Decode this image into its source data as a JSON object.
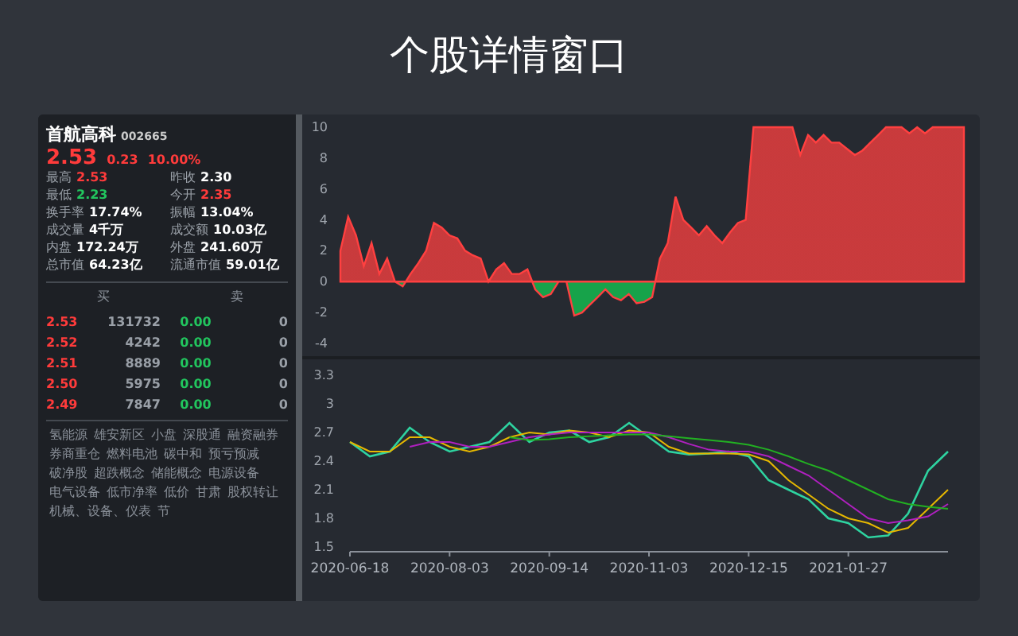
{
  "title": "个股详情窗口",
  "stock": {
    "name": "首航高科",
    "code": "002665",
    "price": "2.53",
    "change": "0.23",
    "change_pct": "10.00%"
  },
  "stats": [
    {
      "label": "最高",
      "value": "2.53",
      "color": "#ff3b3b"
    },
    {
      "label": "昨收",
      "value": "2.30",
      "color": "#ffffff"
    },
    {
      "label": "最低",
      "value": "2.23",
      "color": "#22c55e"
    },
    {
      "label": "今开",
      "value": "2.35",
      "color": "#ff3b3b"
    },
    {
      "label": "换手率",
      "value": "17.74%",
      "color": "#ffffff"
    },
    {
      "label": "振幅",
      "value": "13.04%",
      "color": "#ffffff"
    },
    {
      "label": "成交量",
      "value": "4千万",
      "color": "#ffffff"
    },
    {
      "label": "成交额",
      "value": "10.03亿",
      "color": "#ffffff"
    },
    {
      "label": "内盘",
      "value": "172.24万",
      "color": "#ffffff"
    },
    {
      "label": "外盘",
      "value": "241.60万",
      "color": "#ffffff"
    },
    {
      "label": "总市值",
      "value": "64.23亿",
      "color": "#ffffff"
    },
    {
      "label": "流通市值",
      "value": "59.01亿",
      "color": "#ffffff"
    }
  ],
  "order_book": {
    "buy_header": "买",
    "sell_header": "卖",
    "rows": [
      {
        "buy_price": "2.53",
        "buy_volume": "131732",
        "sell_price": "0.00",
        "sell_volume": "0"
      },
      {
        "buy_price": "2.52",
        "buy_volume": "4242",
        "sell_price": "0.00",
        "sell_volume": "0"
      },
      {
        "buy_price": "2.51",
        "buy_volume": "8889",
        "sell_price": "0.00",
        "sell_volume": "0"
      },
      {
        "buy_price": "2.50",
        "buy_volume": "5975",
        "sell_price": "0.00",
        "sell_volume": "0"
      },
      {
        "buy_price": "2.49",
        "buy_volume": "7847",
        "sell_price": "0.00",
        "sell_volume": "0"
      }
    ]
  },
  "tags": [
    "氢能源",
    "雄安新区",
    "小盘",
    "深股通",
    "融资融券",
    "券商重仓",
    "燃料电池",
    "碳中和",
    "预亏预减",
    "破净股",
    "超跌概念",
    "储能概念",
    "电源设备",
    "电气设备",
    "低市净率",
    "低价",
    "甘肃",
    "股权转让",
    "机械、设备、仪表",
    "节"
  ],
  "change_chart": {
    "chart_data": {
      "type": "area",
      "ylim": [
        -4,
        10
      ],
      "yticks": [
        -4,
        -2,
        0,
        2,
        4,
        6,
        8,
        10
      ],
      "categories": [
        null,
        null,
        null,
        null,
        null,
        null,
        null,
        null,
        null,
        null,
        null,
        null,
        null,
        null,
        null,
        null,
        null,
        null,
        null,
        null,
        null,
        null,
        null,
        null,
        null,
        null,
        null,
        null,
        null,
        null,
        null,
        null,
        null,
        null,
        null,
        null,
        null,
        null,
        null,
        null,
        null,
        null,
        null,
        null,
        null,
        null,
        null,
        null,
        null,
        null,
        null,
        null,
        null,
        null,
        null,
        null,
        null,
        null,
        null,
        null,
        null,
        null,
        null,
        null,
        null,
        null,
        null,
        null,
        null,
        null,
        null,
        null,
        null,
        null,
        null,
        null,
        null,
        null,
        null,
        null,
        null
      ],
      "series": [
        {
          "color": "#ff4040",
          "values": [
            2,
            4.2,
            3,
            1,
            2.5,
            0.5,
            1.5,
            0,
            -0.3,
            0.5,
            1.2,
            2,
            3.8,
            3.5,
            3,
            2.8,
            2,
            1.7,
            1.5,
            0,
            0.8,
            1.2,
            0.5,
            0.5,
            0.8,
            -0.5,
            -1,
            -0.8,
            0,
            0,
            -2.2,
            -2,
            -1.5,
            -1,
            -0.5,
            -1,
            -1.2,
            -0.8,
            -1.4,
            -1.3,
            -1,
            1.5,
            2.5,
            5.5,
            4,
            3.5,
            3,
            3.6,
            3,
            2.5,
            3.2,
            3.8,
            4,
            10,
            10,
            10,
            10,
            10,
            10,
            8.2,
            9.5,
            9,
            9.5,
            9,
            9,
            8.6,
            8.2,
            8.5,
            9,
            9.5,
            10,
            10,
            10,
            9.6,
            10,
            9.6,
            10,
            10,
            10,
            10,
            10
          ]
        }
      ]
    }
  },
  "price_chart": {
    "chart_data": {
      "type": "line",
      "ylim": [
        1.5,
        3.3
      ],
      "yticks": [
        1.5,
        1.8,
        2.1,
        2.4,
        2.7,
        3,
        3.3
      ],
      "categories": [
        "2020-06-18",
        null,
        null,
        null,
        null,
        "2020-08-03",
        null,
        null,
        null,
        null,
        "2020-09-14",
        null,
        null,
        null,
        null,
        "2020-11-03",
        null,
        null,
        null,
        null,
        "2020-12-15",
        null,
        null,
        null,
        null,
        "2021-01-27",
        null,
        null,
        null,
        null,
        null
      ],
      "series": [
        {
          "color": "#2ed3a0",
          "values": [
            2.6,
            2.45,
            2.5,
            2.75,
            2.6,
            2.5,
            2.55,
            2.6,
            2.8,
            2.6,
            2.7,
            2.72,
            2.6,
            2.65,
            2.8,
            2.65,
            2.5,
            2.47,
            2.48,
            2.5,
            2.45,
            2.2,
            2.1,
            2.0,
            1.8,
            1.75,
            1.6,
            1.62,
            1.85,
            2.3,
            2.5
          ]
        },
        {
          "color": "#e6b800",
          "values": [
            2.6,
            2.5,
            2.5,
            2.65,
            2.65,
            2.55,
            2.5,
            2.55,
            2.65,
            2.7,
            2.68,
            2.72,
            2.7,
            2.65,
            2.72,
            2.7,
            2.55,
            2.48,
            2.48,
            2.48,
            2.47,
            2.4,
            2.2,
            2.05,
            1.9,
            1.8,
            1.75,
            1.65,
            1.7,
            1.9,
            2.1
          ]
        },
        {
          "color": "#b020c0",
          "values": [
            null,
            null,
            null,
            2.55,
            2.6,
            2.6,
            2.55,
            2.55,
            2.6,
            2.65,
            2.68,
            2.7,
            2.7,
            2.7,
            2.7,
            2.7,
            2.65,
            2.58,
            2.52,
            2.5,
            2.5,
            2.45,
            2.35,
            2.25,
            2.1,
            1.95,
            1.8,
            1.75,
            1.78,
            1.82,
            1.95
          ]
        },
        {
          "color": "#22b022",
          "values": [
            null,
            null,
            null,
            null,
            null,
            null,
            null,
            null,
            2.65,
            2.62,
            2.63,
            2.65,
            2.66,
            2.67,
            2.68,
            2.68,
            2.66,
            2.64,
            2.62,
            2.6,
            2.57,
            2.52,
            2.45,
            2.37,
            2.3,
            2.2,
            2.1,
            2.0,
            1.95,
            1.92,
            1.9
          ]
        }
      ]
    }
  }
}
